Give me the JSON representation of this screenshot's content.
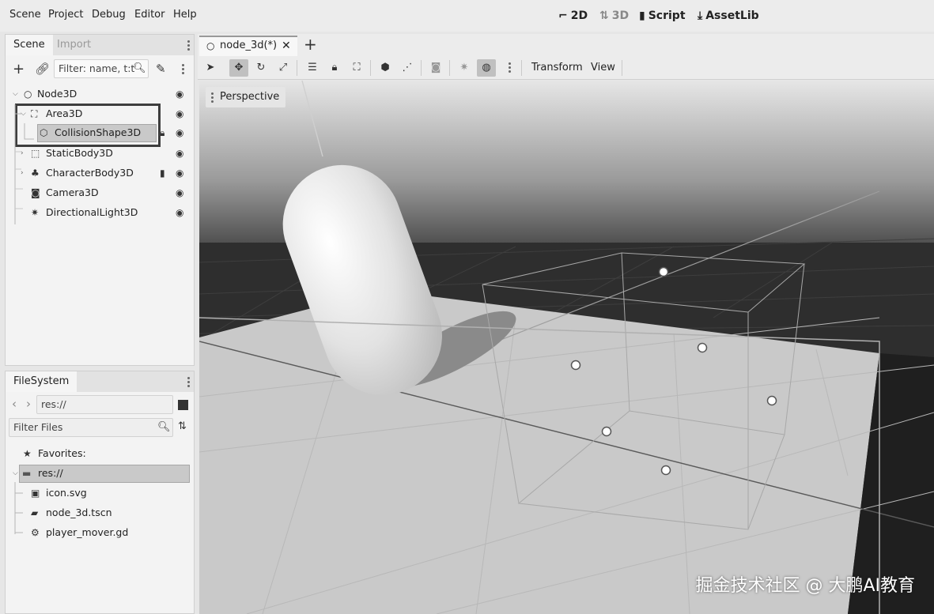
{
  "menubar": {
    "items": [
      "Scene",
      "Project",
      "Debug",
      "Editor",
      "Help"
    ],
    "workspaces": [
      {
        "label": "2D",
        "icon": "2d-workspace-icon",
        "active": true
      },
      {
        "label": "3D",
        "icon": "3d-workspace-icon",
        "active": false
      },
      {
        "label": "Script",
        "icon": "script-icon",
        "active": true
      },
      {
        "label": "AssetLib",
        "icon": "assetlib-icon",
        "active": true
      }
    ]
  },
  "scene_dock": {
    "tabs": [
      "Scene",
      "Import"
    ],
    "filter_placeholder": "Filter: name, t:t",
    "tree": [
      {
        "label": "Node3D",
        "icon": "node3d-icon"
      },
      {
        "label": "Area3D",
        "icon": "area3d-icon"
      },
      {
        "label": "CollisionShape3D",
        "icon": "collisionshape3d-icon",
        "selected": true,
        "locked": true
      },
      {
        "label": "StaticBody3D",
        "icon": "staticbody3d-icon"
      },
      {
        "label": "CharacterBody3D",
        "icon": "characterbody3d-icon",
        "has_script": true
      },
      {
        "label": "Camera3D",
        "icon": "camera3d-icon"
      },
      {
        "label": "DirectionalLight3D",
        "icon": "directionallight3d-icon"
      }
    ]
  },
  "filesystem_dock": {
    "tab": "FileSystem",
    "path": "res://",
    "filter_placeholder": "Filter Files",
    "favorites_label": "Favorites:",
    "root_label": "res://",
    "files": [
      {
        "label": "icon.svg",
        "icon": "image-file-icon"
      },
      {
        "label": "node_3d.tscn",
        "icon": "scene-file-icon"
      },
      {
        "label": "player_mover.gd",
        "icon": "script-file-icon"
      }
    ]
  },
  "editor": {
    "tab_label": "node_3d(*)",
    "toolbar": {
      "transform_label": "Transform",
      "view_label": "View"
    },
    "viewport": {
      "perspective_label": "Perspective"
    }
  },
  "watermark": "掘金技术社区 @ 大鹏AI教育"
}
